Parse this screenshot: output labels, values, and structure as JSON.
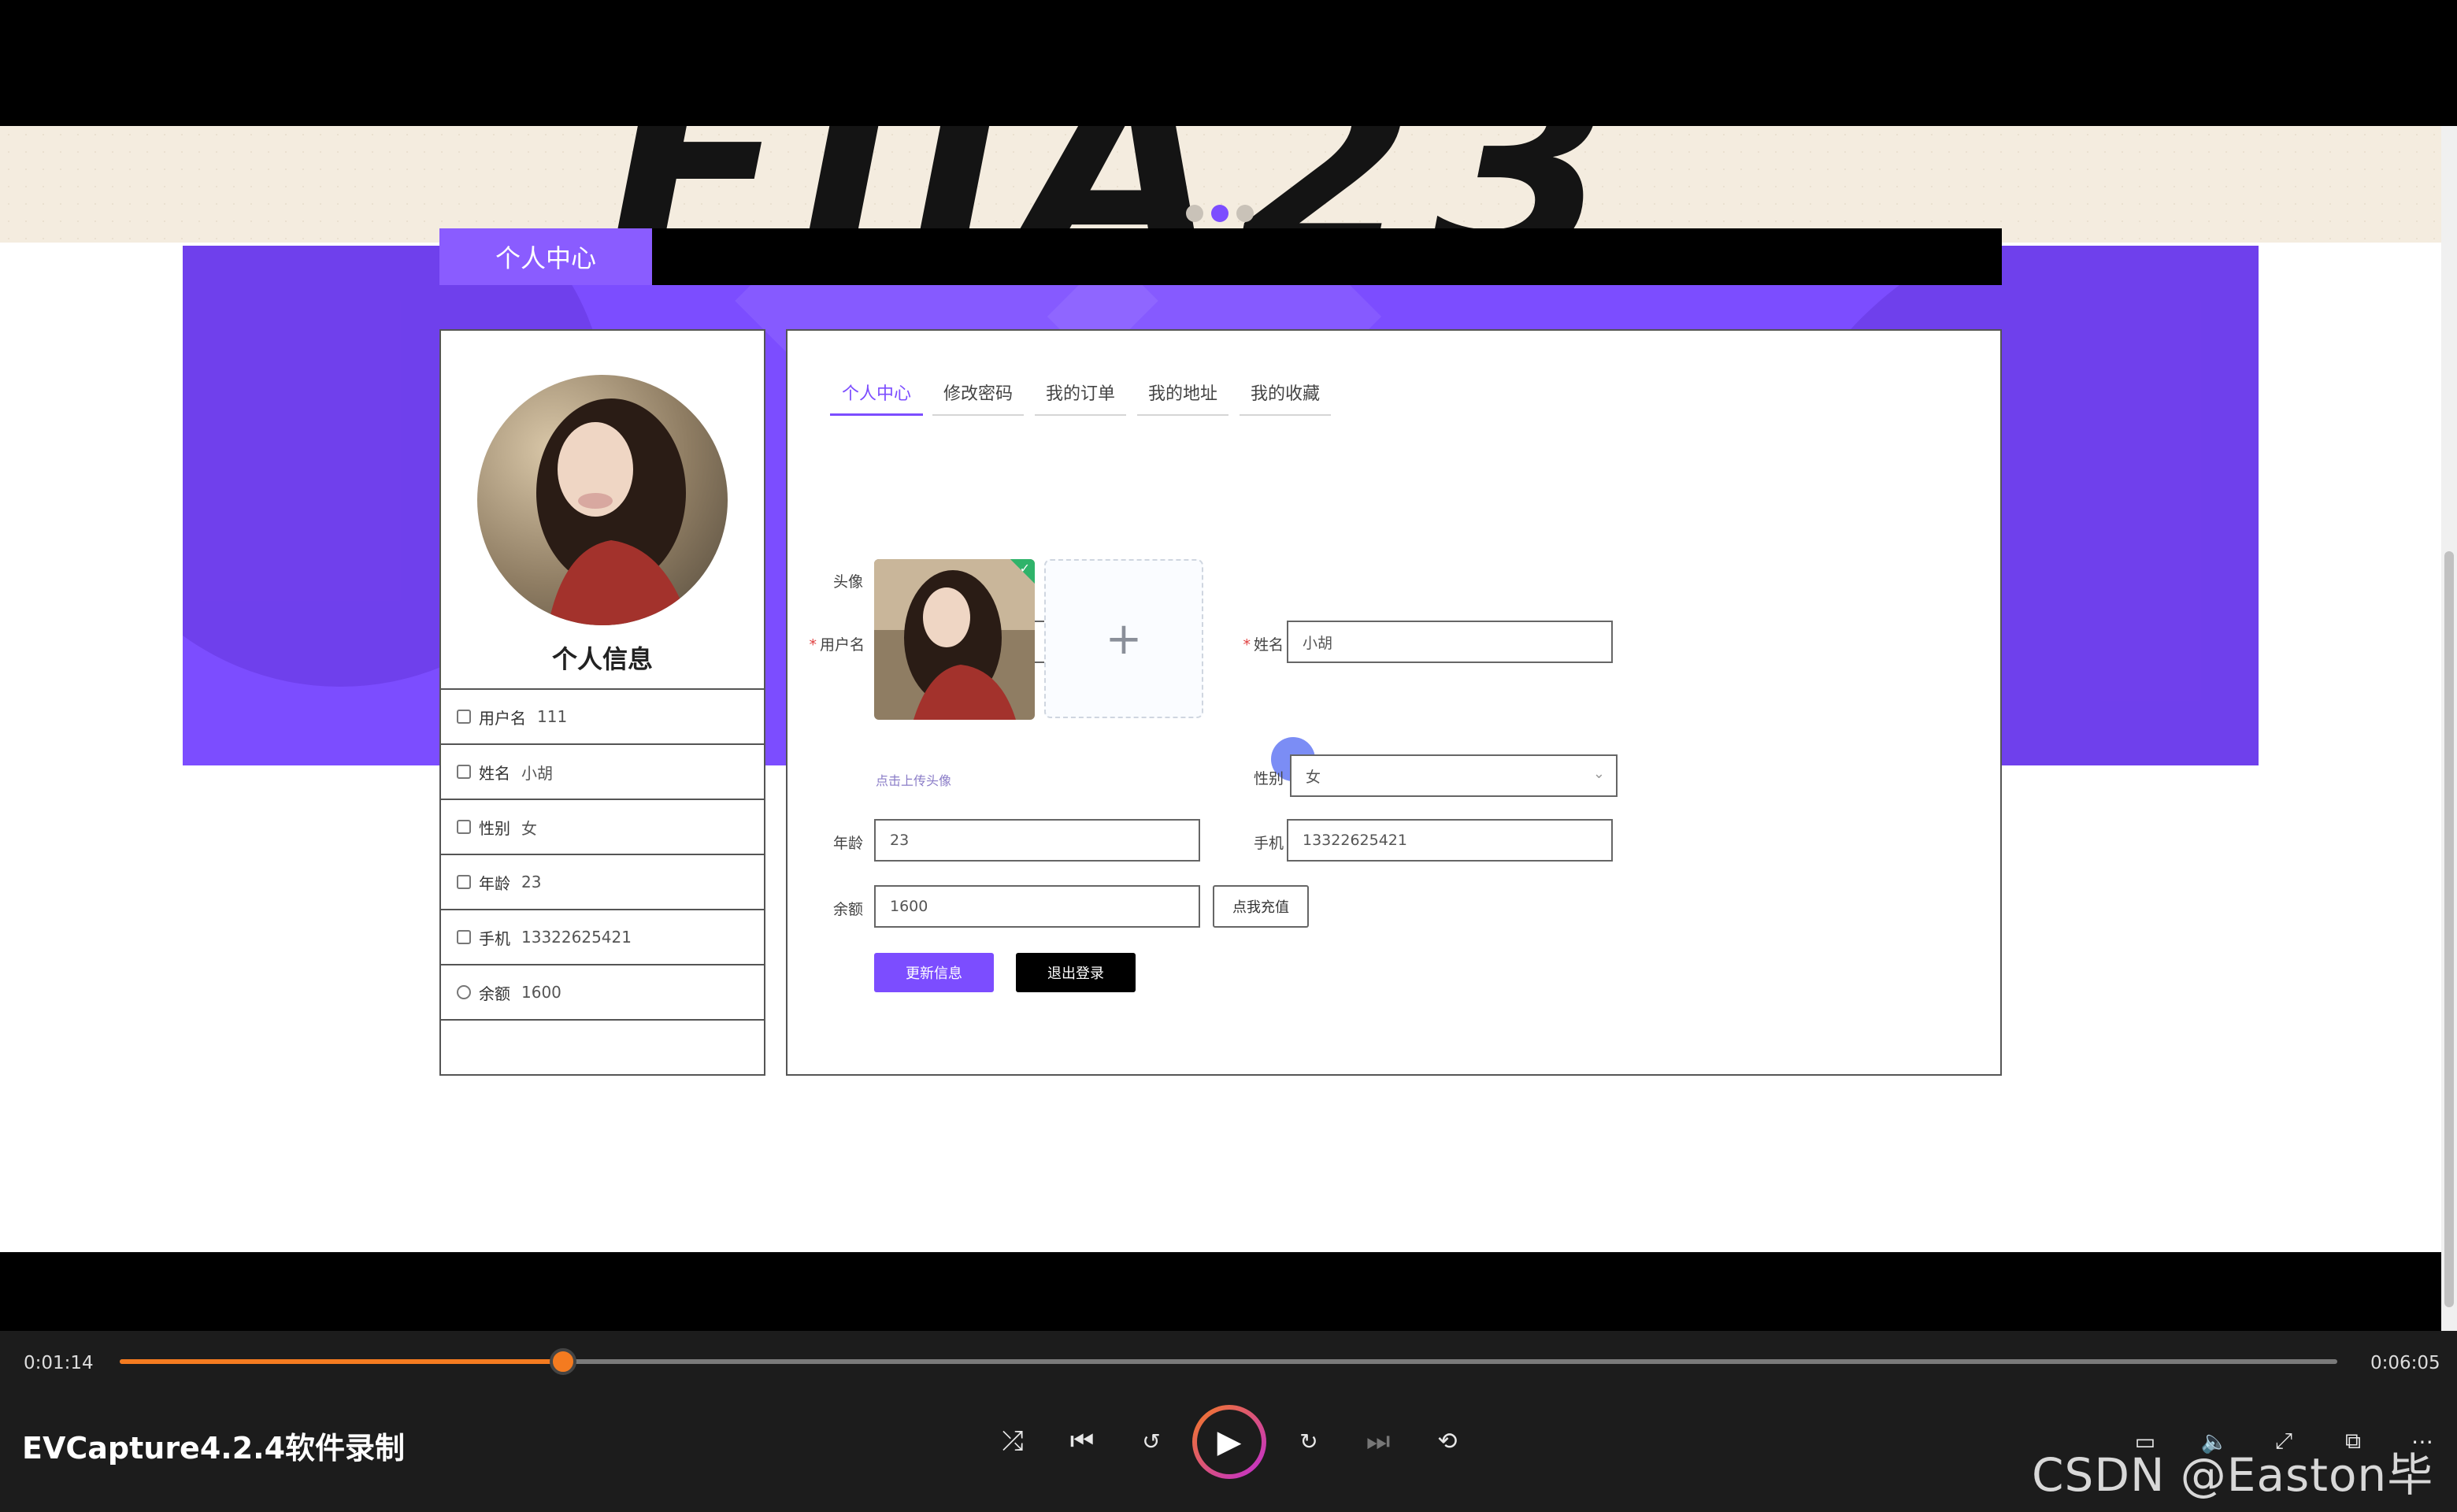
{
  "page": {
    "title_tab": "个人中心",
    "profile_card": {
      "title": "个人信息",
      "rows": [
        {
          "icon": "user-icon",
          "label": "用户名",
          "value": "111"
        },
        {
          "icon": "id-card-icon",
          "label": "姓名",
          "value": "小胡"
        },
        {
          "icon": "chat-icon",
          "label": "性别",
          "value": "女"
        },
        {
          "icon": "edit-icon",
          "label": "年龄",
          "value": "23"
        },
        {
          "icon": "person-icon",
          "label": "手机",
          "value": "13322625421"
        },
        {
          "icon": "clock-icon",
          "label": "余额",
          "value": "1600"
        }
      ]
    },
    "tabs": [
      "个人中心",
      "修改密码",
      "我的订单",
      "我的地址",
      "我的收藏"
    ],
    "form": {
      "username_label": "用户名",
      "username_value": "111",
      "name_label": "姓名",
      "name_value": "小胡",
      "avatar_label": "头像",
      "upload_plus": "+",
      "upload_hint": "点击上传头像",
      "gender_label": "性别",
      "gender_value": "女",
      "age_label": "年龄",
      "age_value": "23",
      "phone_label": "手机",
      "phone_value": "13322625421",
      "balance_label": "余额",
      "balance_value": "1600",
      "recharge_button": "点我充值",
      "update_button": "更新信息",
      "logout_button": "退出登录"
    },
    "colors": {
      "accent": "#7c4dff"
    }
  },
  "player": {
    "current_time": "0:01:14",
    "total_time": "0:06:05",
    "progress": 0.2
  },
  "app_title": "EVCapture4.2.4软件录制",
  "watermark": "CSDN @Easton毕设"
}
